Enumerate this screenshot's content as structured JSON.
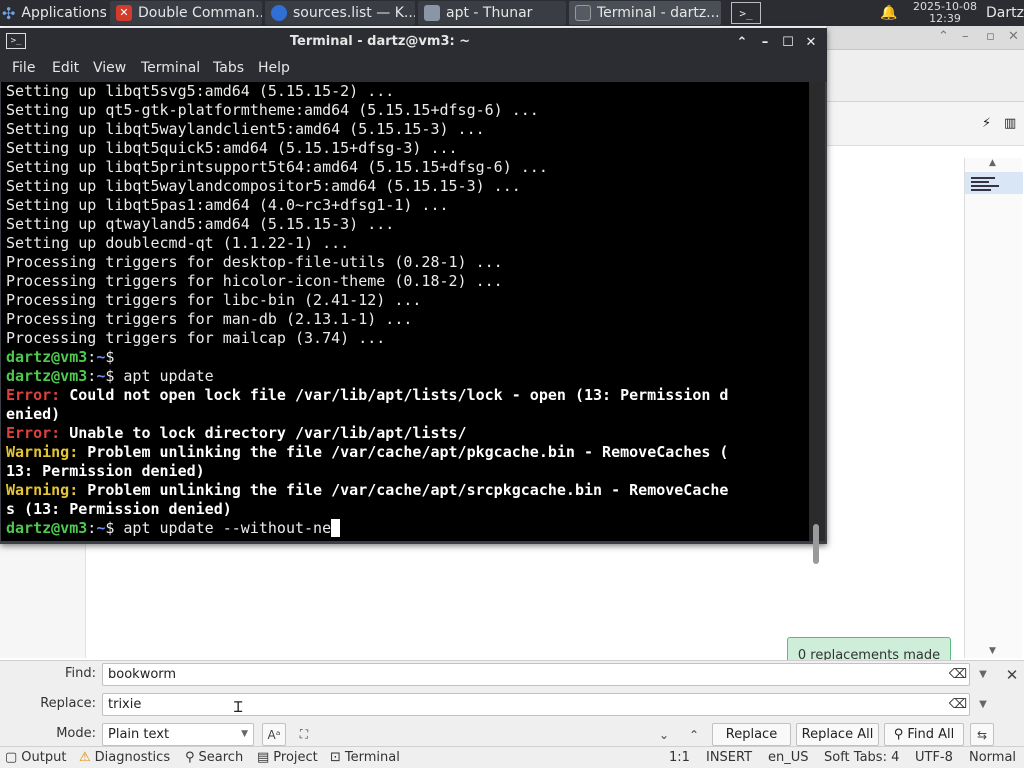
{
  "taskbar": {
    "apps_label": "Applications",
    "windows": [
      {
        "title": "Double Comman...",
        "icon": "doublecmd-icon",
        "color": "#d33b2c"
      },
      {
        "title": "sources.list — K...",
        "icon": "kate-icon",
        "color": "#2f6fd6"
      },
      {
        "title": "apt - Thunar",
        "icon": "folder-icon",
        "color": "#8a96a8"
      },
      {
        "title": "Terminal - dartz...",
        "icon": "terminal-icon",
        "color": "#555a63"
      }
    ],
    "clock_date": "2025-10-08",
    "clock_time": "12:39",
    "user": "Dartz"
  },
  "terminal": {
    "title": "Terminal - dartz@vm3: ~",
    "menu": [
      "File",
      "Edit",
      "View",
      "Terminal",
      "Tabs",
      "Help"
    ],
    "output_lines": [
      "Setting up libqt5svg5:amd64 (5.15.15-2) ...",
      "Setting up qt5-gtk-platformtheme:amd64 (5.15.15+dfsg-6) ...",
      "Setting up libqt5waylandclient5:amd64 (5.15.15-3) ...",
      "Setting up libqt5quick5:amd64 (5.15.15+dfsg-3) ...",
      "Setting up libqt5printsupport5t64:amd64 (5.15.15+dfsg-6) ...",
      "Setting up libqt5waylandcompositor5:amd64 (5.15.15-3) ...",
      "Setting up libqt5pas1:amd64 (4.0~rc3+dfsg1-1) ...",
      "Setting up qtwayland5:amd64 (5.15.15-3) ...",
      "Setting up doublecmd-qt (1.1.22-1) ...",
      "Processing triggers for desktop-file-utils (0.28-1) ...",
      "Processing triggers for hicolor-icon-theme (0.18-2) ...",
      "Processing triggers for libc-bin (2.41-12) ...",
      "Processing triggers for man-db (2.13.1-1) ...",
      "Processing triggers for mailcap (3.74) ..."
    ],
    "prompt_user": "dartz@vm3",
    "prompt_sep": ":",
    "prompt_path": "~",
    "prompt_sym": "$",
    "cmd_update": " apt update",
    "err_label": "Error:",
    "err1_a": " Could not open lock file /var/lib/apt/lists/lock - open (13: Permission d",
    "err1_b": "enied)",
    "err2": " Unable to lock directory /var/lib/apt/lists/",
    "warn_label": "Warning:",
    "warn1_a": " Problem unlinking the file /var/cache/apt/pkgcache.bin - RemoveCaches (",
    "warn1_b": "13: Permission denied)",
    "warn2_a": " Problem unlinking the file /var/cache/apt/srcpkgcache.bin - RemoveCache",
    "warn2_b": "s (13: Permission denied)",
    "cmd_current": " apt update --without-ne",
    "cursor": " "
  },
  "editor": {
    "toast": "0 replacements made",
    "find_label": "Find:",
    "find_value": "bookworm",
    "replace_label": "Replace:",
    "replace_value": "trixie",
    "mode_label": "Mode:",
    "mode_value": "Plain text",
    "replace_btn": "Replace",
    "replace_all_btn": "Replace All",
    "find_all_btn": "Find All"
  },
  "statusbar": {
    "output": "Output",
    "diagnostics": "Diagnostics",
    "search": "Search",
    "project": "Project",
    "terminal": "Terminal",
    "position": "1:1",
    "insert_mode": "INSERT",
    "language": "en_US",
    "tabs": "Soft Tabs: 4",
    "encoding": "UTF-8",
    "input_mode": "Normal"
  }
}
